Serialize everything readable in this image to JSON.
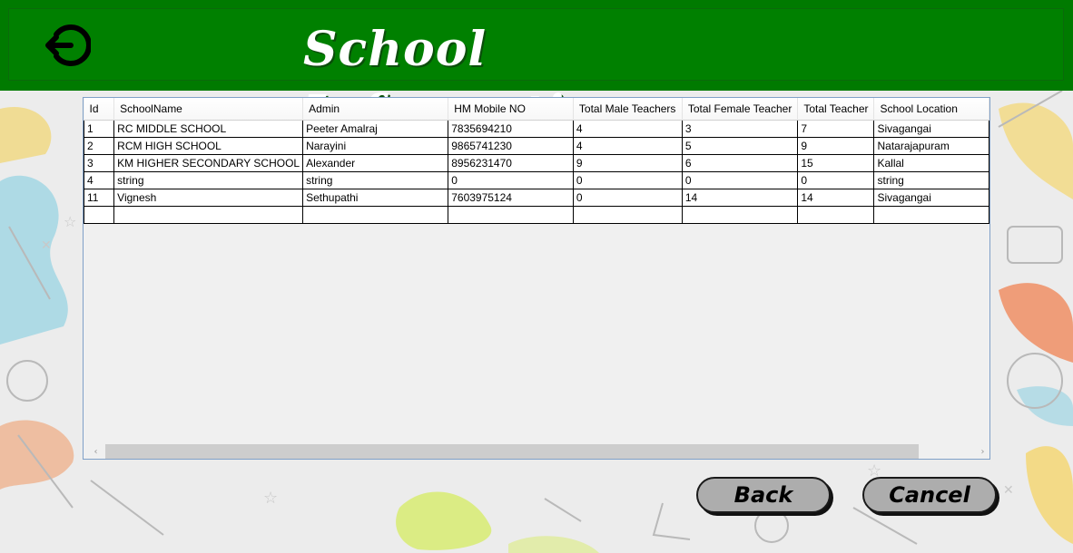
{
  "header": {
    "title": "School Informations",
    "back_icon": "logout-back-icon",
    "color": "#008000"
  },
  "grid": {
    "columns": [
      "Id",
      "SchoolName",
      "Admin",
      "HM Mobile NO",
      "Total Male Teachers",
      "Total Female Teacher",
      "Total Teacher",
      "School Location"
    ],
    "rows": [
      [
        "1",
        "RC MIDDLE SCHOOL",
        "Peeter Amalraj",
        "7835694210",
        "4",
        "3",
        "7",
        "Sivagangai"
      ],
      [
        "2",
        "RCM HIGH SCHOOL",
        "Narayini",
        "9865741230",
        "4",
        "5",
        "9",
        "Natarajapuram"
      ],
      [
        "3",
        "KM HIGHER SECONDARY SCHOOL",
        "Alexander",
        "8956231470",
        "9",
        "6",
        "15",
        "Kallal"
      ],
      [
        "4",
        "string",
        "string",
        "0",
        "0",
        "0",
        "0",
        "string"
      ],
      [
        "11",
        "Vignesh",
        "Sethupathi",
        "7603975124",
        "0",
        "14",
        "14",
        "Sivagangai"
      ],
      [
        "",
        "",
        "",
        "",
        "",
        "",
        "",
        ""
      ]
    ]
  },
  "buttons": {
    "back_label": "Back",
    "cancel_label": "Cancel"
  }
}
